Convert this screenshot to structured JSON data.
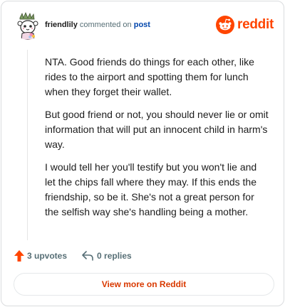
{
  "comment": {
    "username": "friendlily",
    "action_text": "commented on",
    "post_link": "post",
    "paragraphs": [
      "NTA. Good friends do things for each other, like rides to the airport and spotting them for lunch when they forget their wallet.",
      "But good friend or not, you should never lie or omit information that will put an innocent child in harm's way.",
      "I would tell her you'll testify but you won't lie and let the chips fall where they may. If this ends the friendship, so be it. She's not a great person for the selfish way she's handling being a mother."
    ]
  },
  "brand": {
    "wordmark": "reddit",
    "icon": "reddit-logo-icon",
    "color": "#ff4500"
  },
  "footer": {
    "upvotes_label": "3 upvotes",
    "upvote_icon": "upvote-arrow-icon",
    "upvote_color": "#ff4500",
    "replies_label": "0 replies",
    "reply_icon": "reply-icon"
  },
  "cta": {
    "label": "View more on Reddit",
    "color": "#d93900"
  },
  "avatar": {
    "icon": "snoo-avatar-icon"
  }
}
